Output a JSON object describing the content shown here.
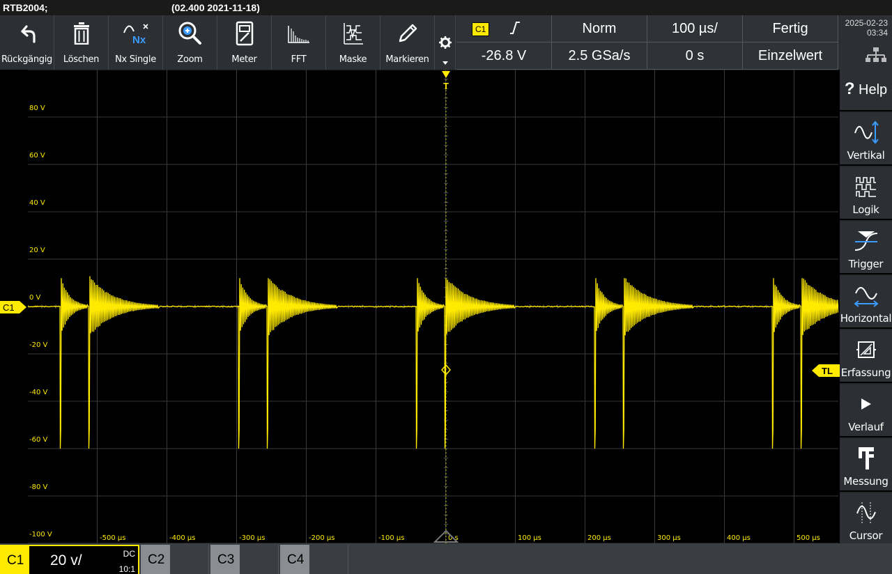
{
  "titlebar": {
    "model": "RTB2004;",
    "firmware": "(02.400 2021-11-18)"
  },
  "toolbar": {
    "undo": "Rückgängig",
    "delete": "Löschen",
    "nx_single": "Nx Single",
    "nx_icon_text": "Nx",
    "zoom": "Zoom",
    "meter": "Meter",
    "fft": "FFT",
    "mask": "Maske",
    "mark": "Markieren"
  },
  "status": {
    "channel": "C1",
    "trigger_mode": "Norm",
    "timebase": "100 µs/",
    "acq_state": "Fertig",
    "trigger_level": "-26.8 V",
    "sample_rate": "2.5 GSa/s",
    "time_offset": "0 s",
    "acq_mode": "Einzelwert"
  },
  "datetime": {
    "date": "2025-02-23",
    "time": "03:34"
  },
  "right_panel": {
    "help": "Help",
    "vertical": "Vertikal",
    "logic": "Logik",
    "trigger": "Trigger",
    "horizontal": "Horizontal",
    "acquisition": "Erfassung",
    "history": "Verlauf",
    "measure": "Messung",
    "cursor": "Cursor"
  },
  "scope": {
    "channel_marker": "C1",
    "trigger_level_marker": "TL",
    "trigger_marker": "T",
    "y_labels": [
      "80 V",
      "60 V",
      "40 V",
      "20 V",
      "0 V",
      "-20 V",
      "-40 V",
      "-60 V",
      "-80 V",
      "-100 V"
    ],
    "x_labels": [
      "-500 µs",
      "-400 µs",
      "-300 µs",
      "-200 µs",
      "-100 µs",
      "0 s",
      "100 µs",
      "200 µs",
      "300 µs",
      "400 µs",
      "500 µs"
    ],
    "trace_color": "#ffea00",
    "grid_color": "#3a3a3a"
  },
  "bottom": {
    "c1": "C1",
    "c1_scale": "20 v/",
    "c1_coupling": "DC",
    "c1_probe": "10:1",
    "c2": "C2",
    "c3": "C3",
    "c4": "C4"
  },
  "colors": {
    "accent": "#ffea00",
    "blue": "#3a9cff",
    "panel": "#2c2f34"
  }
}
